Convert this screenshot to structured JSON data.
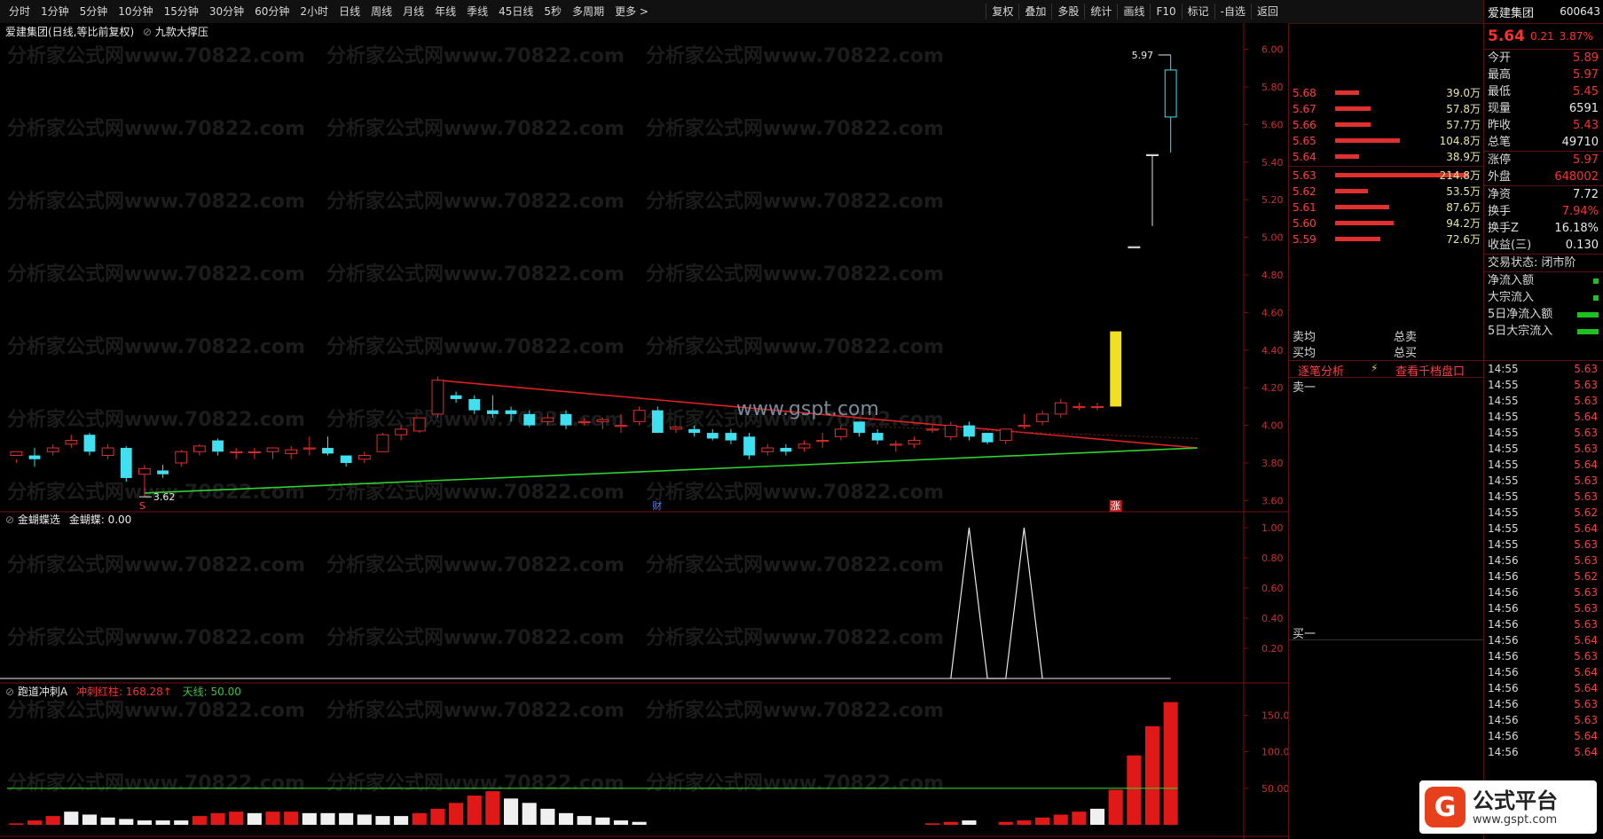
{
  "toolbar": {
    "periods": [
      "分时",
      "1分钟",
      "5分钟",
      "10分钟",
      "15分钟",
      "30分钟",
      "60分钟",
      "2小时",
      "日线",
      "周线",
      "月线",
      "年线",
      "季线",
      "45日线",
      "5秒",
      "多周期",
      "更多 >"
    ],
    "tools": [
      "复权",
      "叠加",
      "多股",
      "统计",
      "画线",
      "F10",
      "标记",
      "-自选",
      "返回"
    ]
  },
  "main_chart": {
    "header": "爱建集团(日线,等比前复权)",
    "indicator_name": "九款大撑压",
    "y_ticks": [
      "6.00",
      "5.80",
      "5.60",
      "5.40",
      "5.20",
      "5.00",
      "4.80",
      "4.60",
      "4.40",
      "4.20",
      "4.00",
      "3.80",
      "3.60"
    ],
    "high_label": "5.97",
    "low_label": "3.62",
    "markers": [
      "S",
      "财",
      "涨"
    ],
    "watermark_text": "www.gspt.com"
  },
  "sub1": {
    "name": "金蝴蝶选",
    "series_label": "金蝴蝶: 0.00",
    "y_ticks": [
      "1.00",
      "0.80",
      "0.60",
      "0.40",
      "0.20"
    ]
  },
  "sub2": {
    "name": "跑道冲刺A",
    "series_label": "冲刺红柱: 168.28↑",
    "line_label": "天线: 50.00",
    "y_ticks": [
      "150.0",
      "100.0",
      "50.00"
    ]
  },
  "chart_data": [
    {
      "type": "candlestick",
      "title": "爱建集团(日线,等比前复权)",
      "ylim": [
        3.55,
        6.05
      ],
      "candles": [
        [
          3.84,
          3.86,
          3.8,
          3.82
        ],
        [
          3.84,
          3.82,
          3.78,
          3.88
        ],
        [
          3.86,
          3.88,
          3.84,
          3.9
        ],
        [
          3.9,
          3.92,
          3.88,
          3.95
        ],
        [
          3.95,
          3.86,
          3.84,
          3.96
        ],
        [
          3.84,
          3.88,
          3.82,
          3.9
        ],
        [
          3.88,
          3.72,
          3.7,
          3.89
        ],
        [
          3.74,
          3.77,
          3.62,
          3.79
        ],
        [
          3.76,
          3.74,
          3.72,
          3.79
        ],
        [
          3.8,
          3.86,
          3.78,
          3.87
        ],
        [
          3.86,
          3.89,
          3.84,
          3.9
        ],
        [
          3.92,
          3.86,
          3.84,
          3.93
        ],
        [
          3.86,
          3.86,
          3.82,
          3.88
        ],
        [
          3.86,
          3.86,
          3.82,
          3.88
        ],
        [
          3.86,
          3.88,
          3.82,
          3.88
        ],
        [
          3.85,
          3.87,
          3.82,
          3.89
        ],
        [
          3.88,
          3.88,
          3.84,
          3.94
        ],
        [
          3.88,
          3.85,
          3.84,
          3.94
        ],
        [
          3.84,
          3.8,
          3.78,
          3.84
        ],
        [
          3.82,
          3.84,
          3.8,
          3.86
        ],
        [
          3.86,
          3.95,
          3.86,
          3.96
        ],
        [
          3.95,
          3.98,
          3.92,
          4.0
        ],
        [
          3.97,
          4.04,
          3.96,
          4.04
        ],
        [
          4.06,
          4.24,
          4.04,
          4.26
        ],
        [
          4.16,
          4.14,
          4.12,
          4.18
        ],
        [
          4.14,
          4.08,
          4.06,
          4.16
        ],
        [
          4.08,
          4.06,
          4.04,
          4.16
        ],
        [
          4.08,
          4.06,
          4.02,
          4.1
        ],
        [
          4.06,
          4.0,
          3.99,
          4.08
        ],
        [
          4.02,
          4.04,
          4.0,
          4.06
        ],
        [
          4.06,
          4.0,
          3.98,
          4.08
        ],
        [
          4.02,
          4.02,
          4.0,
          4.04
        ],
        [
          4.02,
          4.03,
          3.98,
          4.04
        ],
        [
          4.0,
          4.0,
          3.96,
          4.06
        ],
        [
          4.02,
          4.08,
          4.0,
          4.1
        ],
        [
          4.08,
          3.96,
          3.96,
          4.1
        ],
        [
          3.98,
          3.99,
          3.96,
          4.0
        ],
        [
          3.98,
          3.96,
          3.94,
          4.0
        ],
        [
          3.96,
          3.93,
          3.92,
          3.98
        ],
        [
          3.96,
          3.92,
          3.9,
          3.98
        ],
        [
          3.94,
          3.84,
          3.82,
          3.96
        ],
        [
          3.86,
          3.88,
          3.84,
          3.9
        ],
        [
          3.88,
          3.86,
          3.84,
          3.9
        ],
        [
          3.88,
          3.9,
          3.86,
          3.92
        ],
        [
          3.92,
          3.92,
          3.88,
          3.96
        ],
        [
          3.94,
          3.98,
          3.92,
          4.0
        ],
        [
          4.02,
          3.96,
          3.94,
          4.02
        ],
        [
          3.96,
          3.92,
          3.9,
          3.98
        ],
        [
          3.9,
          3.9,
          3.86,
          3.92
        ],
        [
          3.9,
          3.92,
          3.88,
          3.94
        ],
        [
          3.98,
          3.98,
          3.96,
          4.0
        ],
        [
          3.94,
          4.0,
          3.92,
          4.02
        ],
        [
          4.0,
          3.94,
          3.92,
          4.02
        ],
        [
          3.96,
          3.91,
          3.9,
          3.96
        ],
        [
          3.92,
          3.98,
          3.9,
          3.98
        ],
        [
          4.0,
          4.0,
          3.98,
          4.06
        ],
        [
          4.02,
          4.06,
          4.0,
          4.08
        ],
        [
          4.06,
          4.12,
          4.04,
          4.14
        ],
        [
          4.1,
          4.1,
          4.08,
          4.12
        ],
        [
          4.1,
          4.1,
          4.08,
          4.12
        ],
        [
          4.1,
          4.5,
          4.1,
          4.5
        ],
        [
          4.95,
          4.95,
          4.95,
          4.95
        ],
        [
          5.44,
          5.44,
          5.06,
          5.44
        ],
        [
          5.64,
          5.89,
          5.45,
          5.97
        ]
      ],
      "resistance_line": [
        [
          23,
          4.24
        ],
        [
          63,
          3.88
        ]
      ],
      "support_line": [
        [
          7,
          3.64
        ],
        [
          63,
          3.88
        ]
      ]
    },
    {
      "type": "line",
      "title": "金蝴蝶选",
      "ylim": [
        0,
        1.0
      ],
      "series": [
        {
          "name": "金蝴蝶",
          "values": [
            [
              51,
              0
            ],
            [
              52,
              1.0
            ],
            [
              53,
              0
            ],
            [
              54,
              0
            ],
            [
              55,
              1.0
            ],
            [
              56,
              0
            ]
          ]
        }
      ]
    },
    {
      "type": "bar",
      "title": "跑道冲刺A",
      "ylim": [
        0,
        170
      ],
      "line_value": 50,
      "series": [
        {
          "name": "冲刺红柱",
          "values": [
            2,
            6,
            12,
            18,
            14,
            10,
            8,
            6,
            6,
            6,
            12,
            16,
            18,
            16,
            18,
            18,
            16,
            16,
            16,
            14,
            12,
            12,
            16,
            22,
            30,
            40,
            46,
            36,
            30,
            22,
            16,
            12,
            10,
            6,
            4,
            0,
            0,
            0,
            0,
            0,
            0,
            0,
            0,
            0,
            0,
            0,
            0,
            0,
            0,
            0,
            2,
            4,
            6,
            0,
            4,
            6,
            10,
            14,
            18,
            22,
            48,
            95,
            135,
            168
          ]
        }
      ],
      "colors": [
        "r",
        "r",
        "r",
        "w",
        "w",
        "w",
        "w",
        "w",
        "w",
        "w",
        "r",
        "r",
        "r",
        "w",
        "r",
        "r",
        "w",
        "w",
        "w",
        "w",
        "w",
        "w",
        "r",
        "r",
        "r",
        "r",
        "r",
        "w",
        "w",
        "w",
        "w",
        "w",
        "w",
        "w",
        "w",
        "n",
        "n",
        "n",
        "n",
        "n",
        "n",
        "n",
        "n",
        "n",
        "n",
        "n",
        "n",
        "n",
        "n",
        "n",
        "r",
        "r",
        "w",
        "n",
        "r",
        "r",
        "r",
        "r",
        "r",
        "w",
        "r",
        "r",
        "r",
        "r"
      ]
    }
  ],
  "orderbook": {
    "asks": [
      [
        "5.68",
        "39.0万"
      ],
      [
        "5.67",
        "57.8万"
      ],
      [
        "5.66",
        "57.7万"
      ],
      [
        "5.65",
        "104.8万"
      ],
      [
        "5.64",
        "38.9万"
      ]
    ],
    "bids": [
      [
        "5.63",
        "214.8万"
      ],
      [
        "5.62",
        "53.5万"
      ],
      [
        "5.61",
        "87.6万"
      ],
      [
        "5.60",
        "94.2万"
      ],
      [
        "5.59",
        "72.6万"
      ]
    ],
    "labels": {
      "sell_avg": "卖均",
      "buy_avg": "买均",
      "total_sell": "总卖",
      "total_buy": "总买",
      "tick_analysis": "逐笔分析",
      "view_orders": "查看千档盘口",
      "sell1": "卖一",
      "buy1": "买一"
    }
  },
  "quote": {
    "name": "爱建集团",
    "code": "600643",
    "price": "5.64",
    "change": "0.21",
    "pct": "3.87%",
    "fields": [
      [
        "今开",
        "5.89"
      ],
      [
        "最高",
        "5.97"
      ],
      [
        "最低",
        "5.45"
      ],
      [
        "现量",
        "6591"
      ],
      [
        "昨收",
        "5.43"
      ],
      [
        "总笔",
        "49710"
      ],
      [
        "涨停",
        "5.97"
      ],
      [
        "外盘",
        "648002"
      ],
      [
        "净资",
        "7.72"
      ],
      [
        "换手",
        "7.94%"
      ],
      [
        "换手Z",
        "16.18%"
      ],
      [
        "收益(三)",
        "0.130"
      ]
    ],
    "status": "交易状态: 闭市阶",
    "flows": [
      "净流入额",
      "大宗流入",
      "5日净流入额",
      "5日大宗流入"
    ]
  },
  "ticks": [
    [
      "14:55",
      "5.63"
    ],
    [
      "14:55",
      "5.63"
    ],
    [
      "14:55",
      "5.63"
    ],
    [
      "14:55",
      "5.64"
    ],
    [
      "14:55",
      "5.63"
    ],
    [
      "14:55",
      "5.63"
    ],
    [
      "14:55",
      "5.64"
    ],
    [
      "14:55",
      "5.63"
    ],
    [
      "14:55",
      "5.63"
    ],
    [
      "14:55",
      "5.62"
    ],
    [
      "14:55",
      "5.64"
    ],
    [
      "14:55",
      "5.63"
    ],
    [
      "14:56",
      "5.63"
    ],
    [
      "14:56",
      "5.62"
    ],
    [
      "14:56",
      "5.63"
    ],
    [
      "14:56",
      "5.63"
    ],
    [
      "14:56",
      "5.63"
    ],
    [
      "14:56",
      "5.64"
    ],
    [
      "14:56",
      "5.63"
    ],
    [
      "14:56",
      "5.64"
    ],
    [
      "14:56",
      "5.64"
    ],
    [
      "14:56",
      "5.63"
    ],
    [
      "14:56",
      "5.63"
    ],
    [
      "14:56",
      "5.64"
    ],
    [
      "14:56",
      "5.64"
    ]
  ],
  "brand": {
    "name": "公式平台",
    "url": "www.gspt.com"
  },
  "watermark": "分析家公式网www.70822.com"
}
